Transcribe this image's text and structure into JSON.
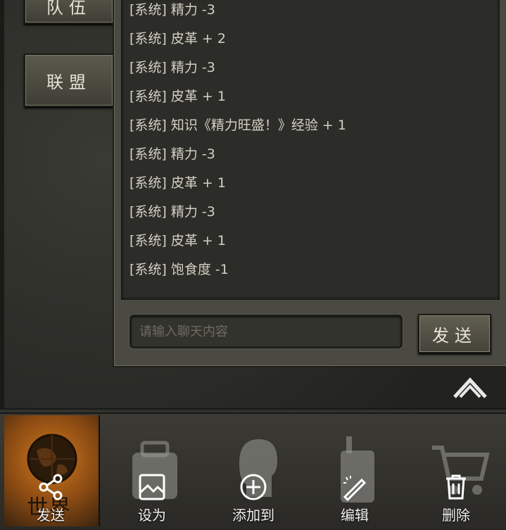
{
  "sidebar": {
    "team_label": "队伍",
    "alliance_label": "联盟"
  },
  "chat": {
    "lines": [
      "[系统] 精力 -3",
      "[系统] 皮革 + 2",
      "[系统] 精力 -3",
      "[系统] 皮革 + 1",
      "[系统] 知识《精力旺盛！》经验 + 1",
      "[系统] 精力 -3",
      "[系统] 皮革 + 1",
      "[系统] 精力 -3",
      "[系统] 皮革 + 1",
      "[系统] 饱食度 -1"
    ],
    "input_placeholder": "请输入聊天内容",
    "send_label": "发送"
  },
  "bottom_bar": {
    "world_label": "世界",
    "actions": [
      {
        "label": "发送",
        "icon": "share-icon"
      },
      {
        "label": "设为",
        "icon": "set-as-icon"
      },
      {
        "label": "添加到",
        "icon": "add-to-icon"
      },
      {
        "label": "编辑",
        "icon": "edit-icon"
      },
      {
        "label": "删除",
        "icon": "delete-icon"
      }
    ]
  },
  "colors": {
    "accent_orange": "#d07a1e",
    "panel": "#4a4a42",
    "log_bg": "#2c2c28"
  }
}
